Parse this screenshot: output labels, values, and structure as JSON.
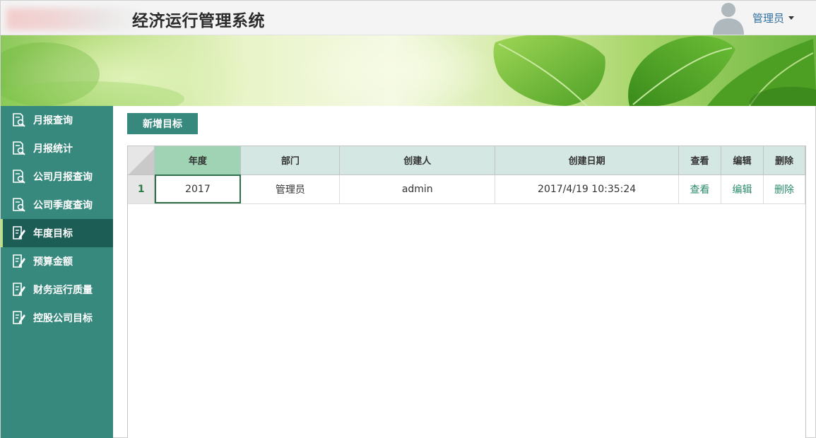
{
  "header": {
    "app_title": "经济运行管理系统",
    "user_name": "管理员"
  },
  "sidebar": {
    "items": [
      {
        "label": "月报查询",
        "icon": "search-doc-icon"
      },
      {
        "label": "月报统计",
        "icon": "search-doc-icon"
      },
      {
        "label": "公司月报查询",
        "icon": "search-doc-icon"
      },
      {
        "label": "公司季度查询",
        "icon": "search-doc-icon"
      },
      {
        "label": "年度目标",
        "icon": "edit-doc-icon",
        "active": true
      },
      {
        "label": "预算金额",
        "icon": "edit-doc-icon"
      },
      {
        "label": "财务运行质量",
        "icon": "edit-doc-icon"
      },
      {
        "label": "控股公司目标",
        "icon": "edit-doc-icon"
      }
    ]
  },
  "toolbar": {
    "add_label": "新增目标"
  },
  "table": {
    "columns": [
      "年度",
      "部门",
      "创建人",
      "创建日期",
      "查看",
      "编辑",
      "删除"
    ],
    "rows": [
      {
        "row_number": "1",
        "year": "2017",
        "department": "管理员",
        "creator": "admin",
        "created_date": "2017/4/19 10:35:24",
        "view_label": "查看",
        "edit_label": "编辑",
        "delete_label": "删除"
      }
    ]
  },
  "colors": {
    "sidebar_bg": "#37887d",
    "sidebar_active_bg": "#1c5e56",
    "header_bg": "#d5e7e3",
    "sorted_header_bg": "#9fd3b3",
    "link": "#2a8c6c",
    "user_link": "#2f6fa0"
  }
}
